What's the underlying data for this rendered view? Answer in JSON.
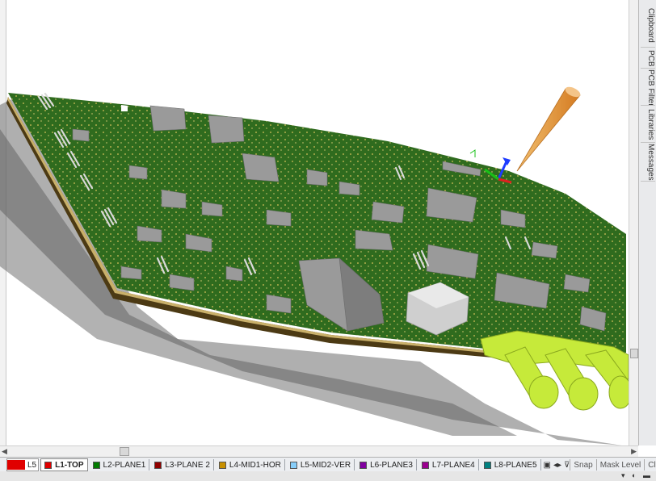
{
  "side_panel": {
    "tabs": [
      "Clipboard",
      "PCB",
      "PCB Filter",
      "Libraries",
      "Messages"
    ]
  },
  "layer_bar": {
    "current_layer": "L5",
    "layers": [
      {
        "name": "L1-TOP",
        "color": "#e00000",
        "active": true
      },
      {
        "name": "L2-PLANE1",
        "color": "#007a00"
      },
      {
        "name": "L3-PLANE 2",
        "color": "#900000"
      },
      {
        "name": "L4-MID1-HOR",
        "color": "#c89000"
      },
      {
        "name": "L5-MID2-VER",
        "color": "#87cefa"
      },
      {
        "name": "L6-PLANE3",
        "color": "#8000a0"
      },
      {
        "name": "L7-PLANE4",
        "color": "#9b0090"
      },
      {
        "name": "L8-PLANE5",
        "color": "#008080"
      }
    ],
    "buttons": {
      "snap": "Snap",
      "mask_level": "Mask Level",
      "clear": "Clear"
    }
  },
  "colors": {
    "board": "#2e6a1f",
    "board_dark": "#1e4714",
    "component": "#9a9a9a",
    "connector": "#c6ea3a",
    "probe": "#e8a040"
  }
}
